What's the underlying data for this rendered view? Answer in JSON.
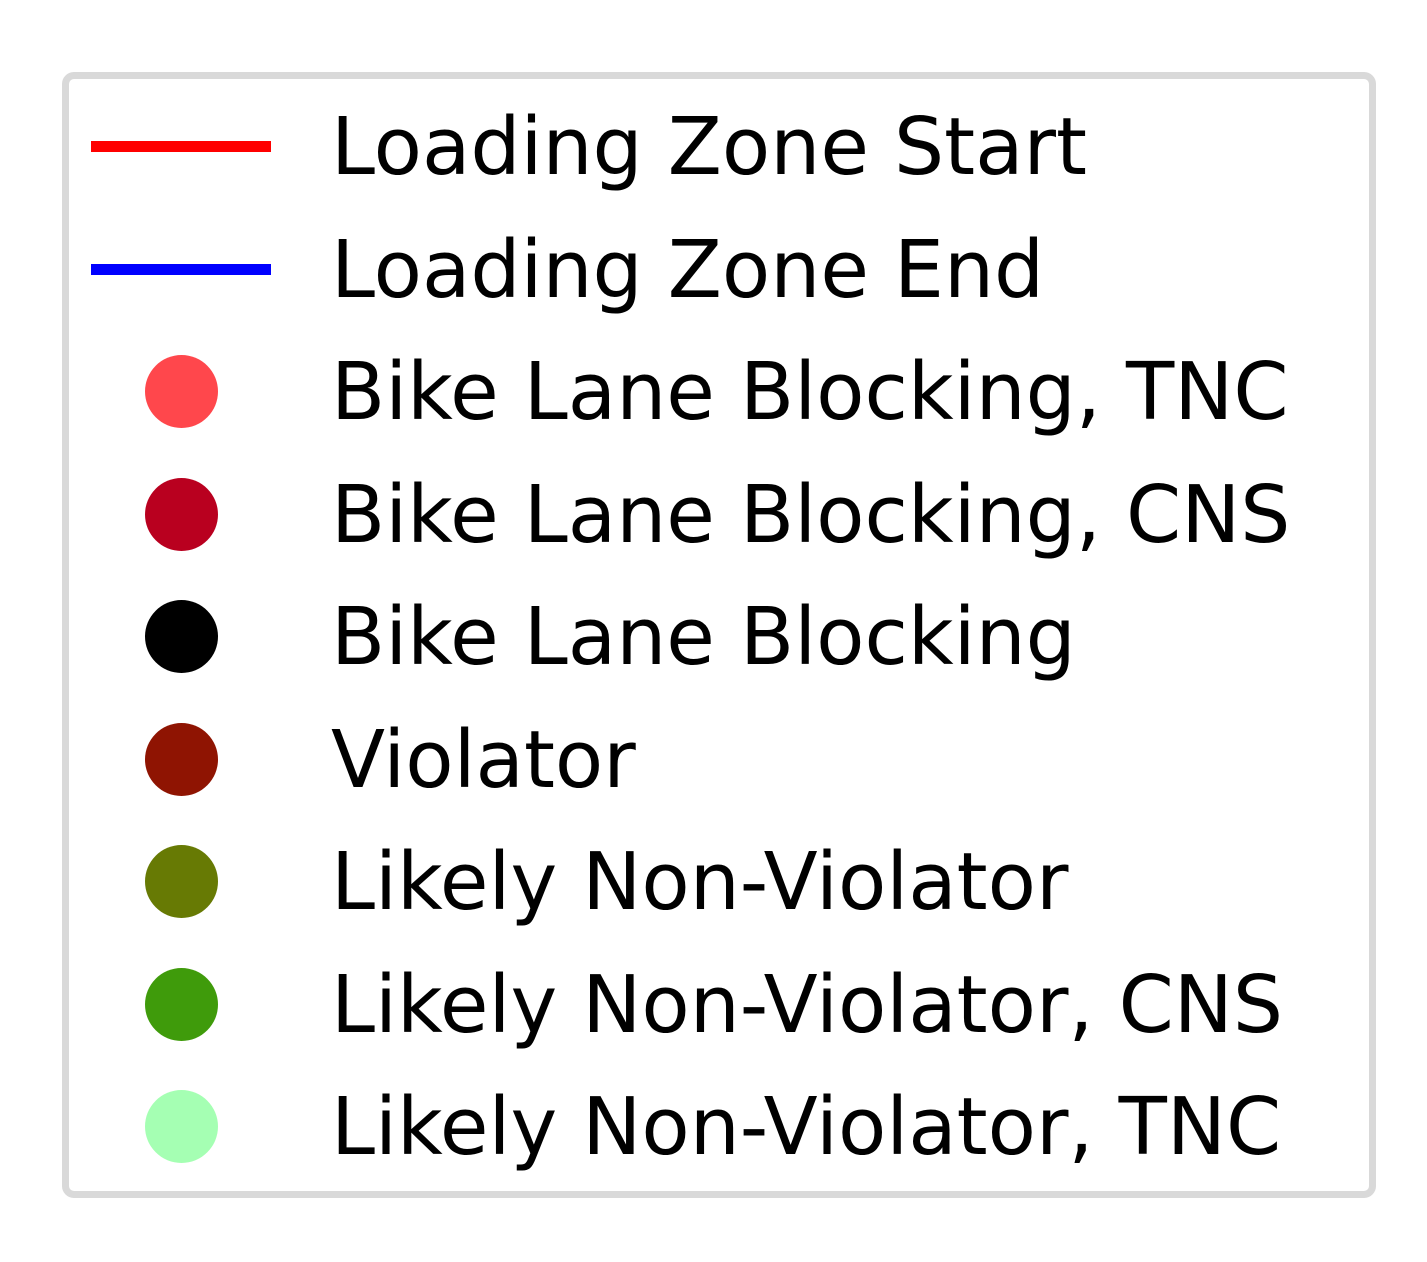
{
  "chart_data": {
    "type": "legend",
    "title": "",
    "legend": [
      {
        "label": "Loading Zone Start",
        "marker": "line",
        "color": "#ff0000"
      },
      {
        "label": "Loading Zone End",
        "marker": "line",
        "color": "#0000ff"
      },
      {
        "label": "Bike Lane Blocking, TNC",
        "marker": "circle",
        "color": "#ff474c"
      },
      {
        "label": "Bike Lane Blocking, CNS",
        "marker": "circle",
        "color": "#b9001f"
      },
      {
        "label": "Bike Lane Blocking",
        "marker": "circle",
        "color": "#000000"
      },
      {
        "label": "Violator",
        "marker": "circle",
        "color": "#8f1402"
      },
      {
        "label": "Likely Non-Violator",
        "marker": "circle",
        "color": "#677a04"
      },
      {
        "label": "Likely Non-Violator, CNS",
        "marker": "circle",
        "color": "#3f9b0b"
      },
      {
        "label": "Likely Non-Violator, TNC",
        "marker": "circle",
        "color": "#a5ffb3"
      }
    ]
  }
}
